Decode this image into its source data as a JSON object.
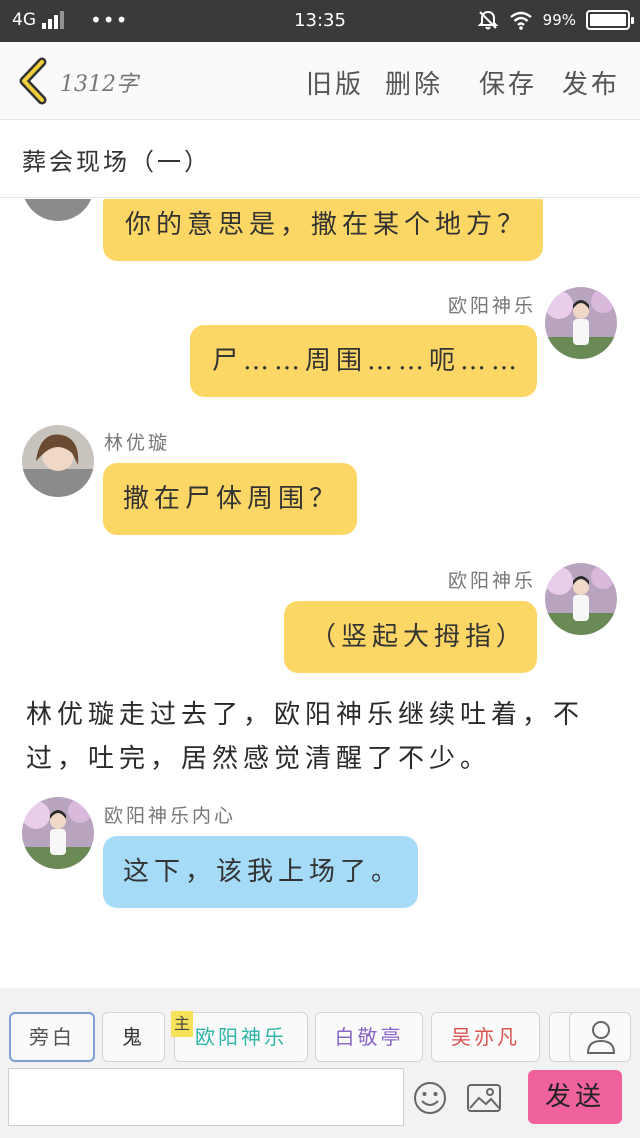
{
  "status_bar": {
    "network": "4G",
    "time": "13:35",
    "battery": "99%",
    "battery_level": 0.99
  },
  "toolbar": {
    "word_count": "1312字",
    "old_version": "旧版",
    "delete": "删除",
    "save": "保存",
    "publish": "发布"
  },
  "title": "葬会现场（一）",
  "messages": [
    {
      "side": "left",
      "text": "你的意思是，撒在某个地方？",
      "color": "#fdd766"
    },
    {
      "side": "right",
      "speaker": "欧阳神乐",
      "text": "尸……周围……呃……",
      "color": "#fdd766"
    },
    {
      "side": "left",
      "speaker": "林优璇",
      "text": "撒在尸体周围？",
      "color": "#fdd766"
    },
    {
      "side": "right",
      "speaker": "欧阳神乐",
      "text": "（竖起大拇指）",
      "color": "#fdd766"
    },
    {
      "type": "narration",
      "text": "林优璇走过去了，欧阳神乐继续吐着，不过，吐完，居然感觉清醒了不少。"
    },
    {
      "side": "left",
      "speaker": "欧阳神乐内心",
      "text": "这下，该我上场了。",
      "color": "#a5dbf7"
    }
  ],
  "characters": [
    {
      "label": "旁白",
      "color": "#555555",
      "selected": true
    },
    {
      "label": "鬼",
      "color": "#333333"
    },
    {
      "label": "欧阳神乐",
      "color": "#2fb5a7",
      "tag": "主"
    },
    {
      "label": "白敬亭",
      "color": "#8a67c6"
    },
    {
      "label": "吴亦凡",
      "color": "#d9534f"
    }
  ],
  "input": {
    "placeholder": ""
  },
  "send_label": "发送"
}
